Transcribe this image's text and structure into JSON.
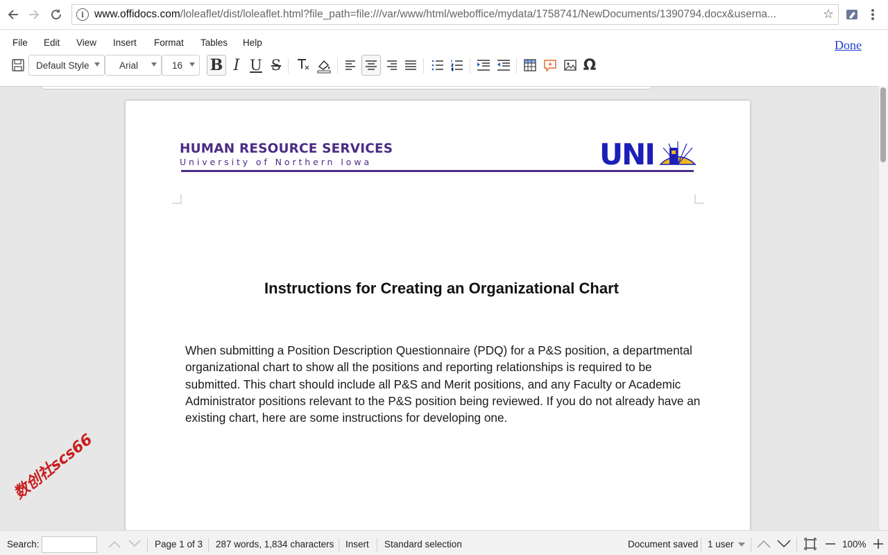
{
  "browser": {
    "url_domain": "www.offidocs.com",
    "url_path": "/loleaflet/dist/loleaflet.html?file_path=file:///var/www/html/weboffice/mydata/1758741/NewDocuments/1390794.docx&userna..."
  },
  "menu": {
    "items": [
      "File",
      "Edit",
      "View",
      "Insert",
      "Format",
      "Tables",
      "Help"
    ],
    "done_label": "Done"
  },
  "toolbar": {
    "paragraph_style": "Default Style",
    "font_name": "Arial",
    "font_size": "16"
  },
  "document": {
    "header_org": "HUMAN RESOURCE SERVICES",
    "header_university": "University of Northern Iowa",
    "logo_text": "UNI",
    "heading": "Instructions for Creating an Organizational Chart",
    "paragraph": "When submitting a Position Description Questionnaire (PDQ) for a P&S position, a departmental organizational chart to show all the positions and reporting relationships is required to be submitted. This chart should include all P&S and Merit positions, and any Faculty or Academic Administrator positions relevant to the P&S position being reviewed. If you do not already have an existing chart, here are some instructions for developing one."
  },
  "watermark": "数创社scs66",
  "status": {
    "search_label": "Search:",
    "page_info": "Page 1 of 3",
    "word_count": "287 words, 1,834 characters",
    "insert_mode": "Insert",
    "selection_mode": "Standard selection",
    "save_state": "Document saved",
    "users": "1 user",
    "zoom": "100%"
  },
  "colors": {
    "brand_purple": "#4b2c85",
    "logo_blue": "#1c1fb8",
    "logo_gold": "#f1b823",
    "done_link": "#1f3fd0"
  }
}
